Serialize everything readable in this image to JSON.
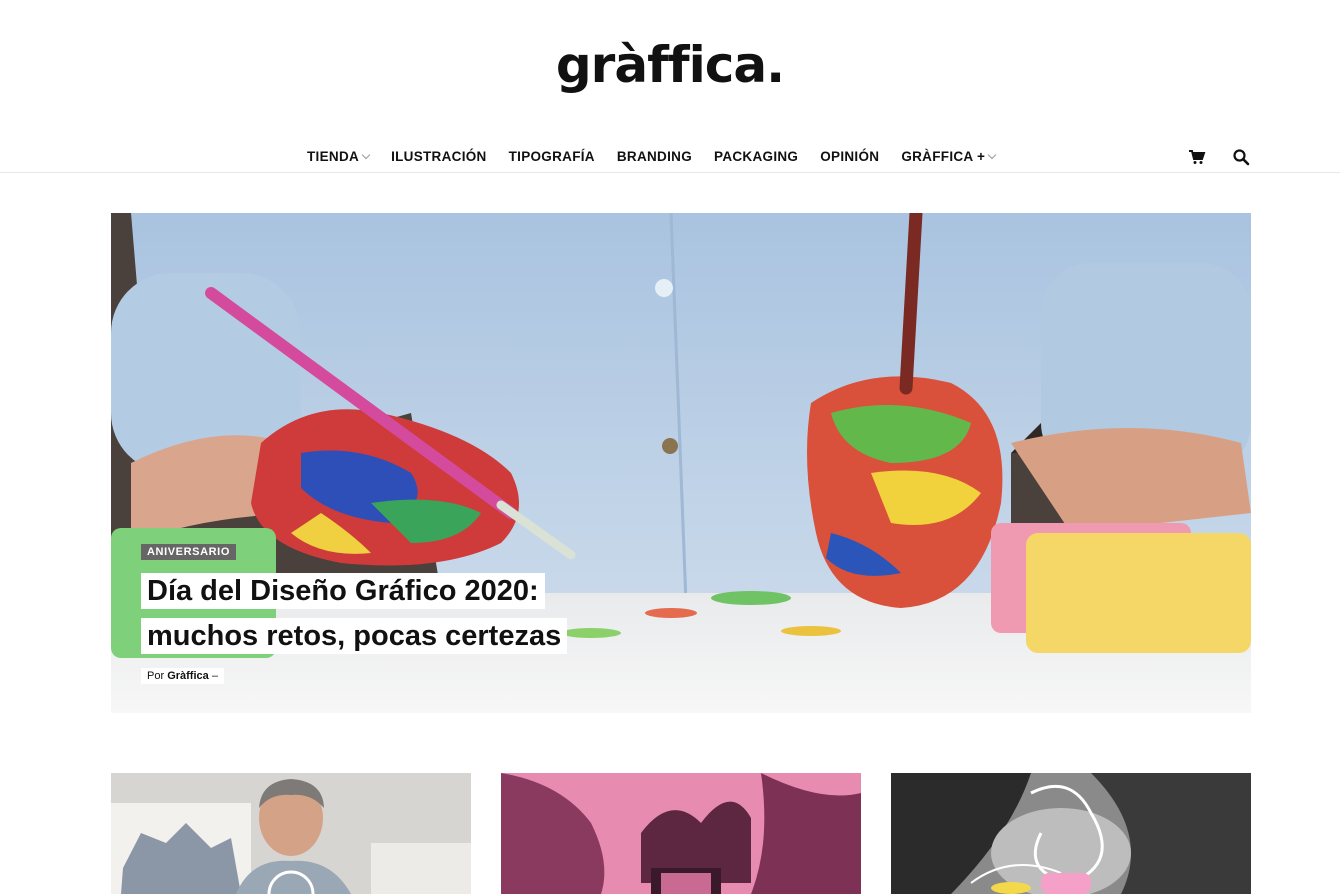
{
  "site": {
    "logo": "gràffica."
  },
  "nav": {
    "items": [
      {
        "label": "TIENDA",
        "has_dropdown": true
      },
      {
        "label": "ILUSTRACIÓN",
        "has_dropdown": false
      },
      {
        "label": "TIPOGRAFÍA",
        "has_dropdown": false
      },
      {
        "label": "BRANDING",
        "has_dropdown": false
      },
      {
        "label": "PACKAGING",
        "has_dropdown": false
      },
      {
        "label": "OPINIÓN",
        "has_dropdown": false
      },
      {
        "label": "GRÀFFICA +",
        "has_dropdown": true
      }
    ],
    "icons": [
      "cart-icon",
      "search-icon"
    ]
  },
  "hero": {
    "category": "ANIVERSARIO",
    "title_line1": "Día del Diseño Gráfico 2020:",
    "title_line2": "muchos retos, pocas certezas",
    "meta_prefix": "Por",
    "author": "Gràffica",
    "meta_suffix": "–"
  },
  "cards": [
    {
      "image": "portrait-man-with-paintings"
    },
    {
      "image": "pink-hands-with-camera"
    },
    {
      "image": "black-white-kiss-collage"
    }
  ],
  "colors": {
    "badge_bg": "#666666",
    "text": "#111111",
    "pink_tint": "#e87ea5"
  }
}
